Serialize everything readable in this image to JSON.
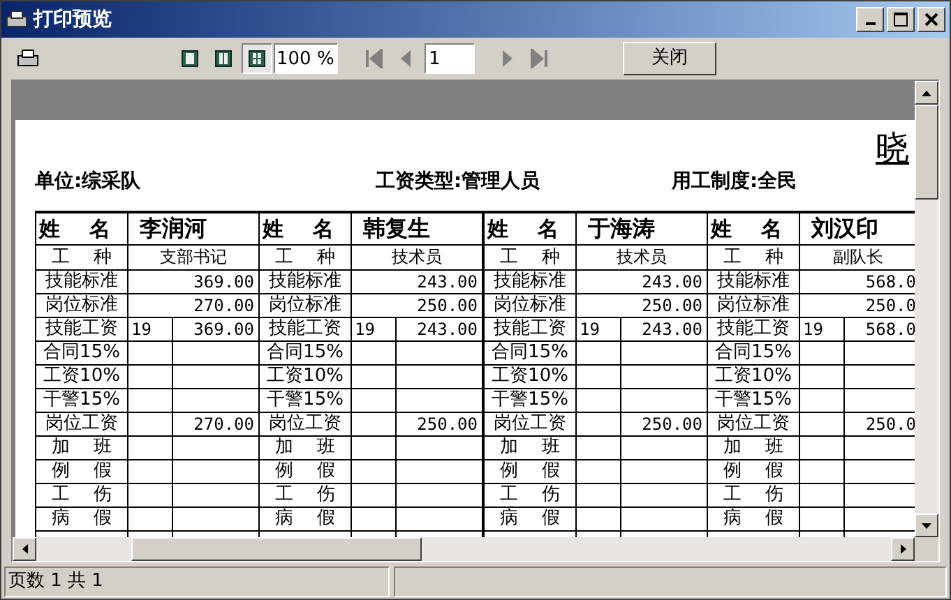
{
  "window": {
    "title": "打印预览"
  },
  "toolbar": {
    "view_buttons": [
      {
        "selected": false
      },
      {
        "selected": false
      },
      {
        "selected": true
      }
    ],
    "zoom": "100 %",
    "page": "1",
    "close_button": "关闭"
  },
  "page": {
    "title": "晓",
    "info": [
      "单位:综采队",
      "工资类型:管理人员",
      "用工制度:全民"
    ],
    "employees": [
      {
        "name_label": "姓    名",
        "name": "李润河",
        "job_label": "工    种",
        "job": "支部书记",
        "rows": [
          {
            "kind": "merged",
            "label": "技能标准",
            "amount": "369.00"
          },
          {
            "kind": "merged",
            "label": "岗位标准",
            "amount": "270.00"
          },
          {
            "kind": "split",
            "label": "技能工资",
            "grade": "19",
            "amount": "369.00"
          },
          {
            "kind": "split",
            "label": "合同15%"
          },
          {
            "kind": "split",
            "label": "工资10%"
          },
          {
            "kind": "split",
            "label": "干警15%"
          },
          {
            "kind": "split",
            "label": "岗位工资",
            "amount": "270.00"
          },
          {
            "kind": "split",
            "label": "加    班"
          },
          {
            "kind": "split",
            "label": "例    假"
          },
          {
            "kind": "split",
            "label": "工    伤"
          },
          {
            "kind": "split",
            "label": "病    假"
          }
        ]
      },
      {
        "name_label": "姓    名",
        "name": "韩复生",
        "job_label": "工    种",
        "job": "技术员",
        "rows": [
          {
            "kind": "merged",
            "label": "技能标准",
            "amount": "243.00"
          },
          {
            "kind": "merged",
            "label": "岗位标准",
            "amount": "250.00"
          },
          {
            "kind": "split",
            "label": "技能工资",
            "grade": "19",
            "amount": "243.00"
          },
          {
            "kind": "split",
            "label": "合同15%"
          },
          {
            "kind": "split",
            "label": "工资10%"
          },
          {
            "kind": "split",
            "label": "干警15%"
          },
          {
            "kind": "split",
            "label": "岗位工资",
            "amount": "250.00"
          },
          {
            "kind": "split",
            "label": "加    班"
          },
          {
            "kind": "split",
            "label": "例    假"
          },
          {
            "kind": "split",
            "label": "工    伤"
          },
          {
            "kind": "split",
            "label": "病    假"
          }
        ]
      },
      {
        "name_label": "姓    名",
        "name": "于海涛",
        "job_label": "工    种",
        "job": "技术员",
        "rows": [
          {
            "kind": "merged",
            "label": "技能标准",
            "amount": "243.00"
          },
          {
            "kind": "merged",
            "label": "岗位标准",
            "amount": "250.00"
          },
          {
            "kind": "split",
            "label": "技能工资",
            "grade": "19",
            "amount": "243.00"
          },
          {
            "kind": "split",
            "label": "合同15%"
          },
          {
            "kind": "split",
            "label": "工资10%"
          },
          {
            "kind": "split",
            "label": "干警15%"
          },
          {
            "kind": "split",
            "label": "岗位工资",
            "amount": "250.00"
          },
          {
            "kind": "split",
            "label": "加    班"
          },
          {
            "kind": "split",
            "label": "例    假"
          },
          {
            "kind": "split",
            "label": "工    伤"
          },
          {
            "kind": "split",
            "label": "病    假"
          }
        ]
      },
      {
        "name_label": "姓    名",
        "name": "刘汉印",
        "job_label": "工    种",
        "job": "副队长",
        "rows": [
          {
            "kind": "merged",
            "label": "技能标准",
            "amount": "568.0"
          },
          {
            "kind": "merged",
            "label": "岗位标准",
            "amount": "250.0"
          },
          {
            "kind": "split",
            "label": "技能工资",
            "grade": "19",
            "amount": "568.0"
          },
          {
            "kind": "split",
            "label": "合同15%"
          },
          {
            "kind": "split",
            "label": "工资10%"
          },
          {
            "kind": "split",
            "label": "干警15%"
          },
          {
            "kind": "split",
            "label": "岗位工资",
            "amount": "250.0"
          },
          {
            "kind": "split",
            "label": "加    班"
          },
          {
            "kind": "split",
            "label": "例    假"
          },
          {
            "kind": "split",
            "label": "工    伤"
          },
          {
            "kind": "split",
            "label": "病    假"
          }
        ]
      }
    ]
  },
  "status_bar": {
    "text": "页数 1 共 1"
  }
}
